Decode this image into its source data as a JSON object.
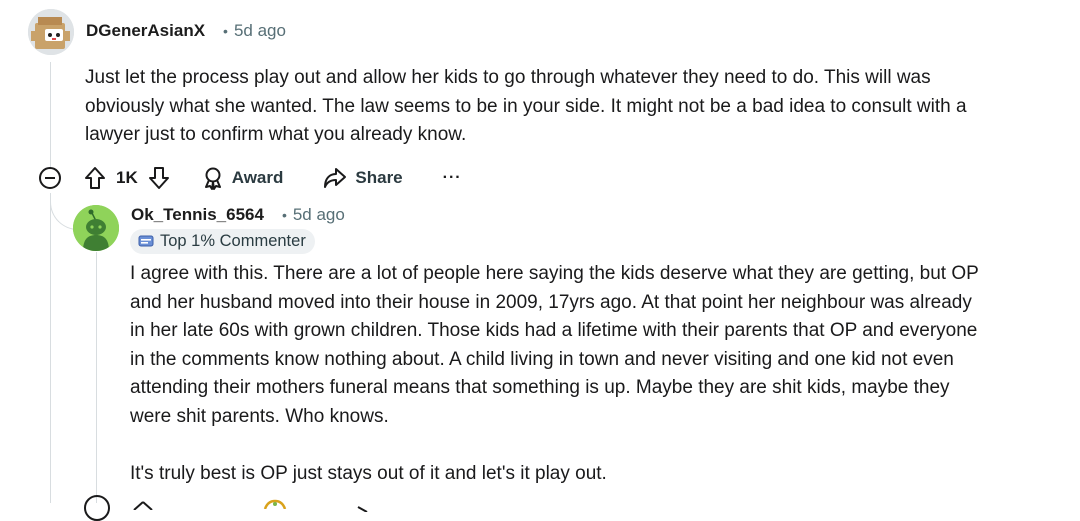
{
  "comment": {
    "username": "DGenerAsianX",
    "separator": "•",
    "time": "5d ago",
    "body_lines": [
      "Just let the process play out and allow her kids to go through whatever they need to do. This will was",
      "obviously what she wanted. The law seems to be in your side. It might not be a bad idea to consult with a",
      "lawyer just to confirm what you already know."
    ],
    "actions": {
      "vote_count": "1K",
      "award_label": "Award",
      "share_label": "Share",
      "more_label": "···"
    }
  },
  "reply": {
    "username": "Ok_Tennis_6564",
    "separator": "•",
    "time": "5d ago",
    "badge_label": "Top 1% Commenter",
    "paragraph1_lines": [
      "I agree with this. There are a lot of people here saying the kids deserve what they are getting, but OP",
      "and her husband moved into their house in 2009, 17yrs ago. At that point her neighbour was already",
      "in her late 60s with grown children. Those kids had a lifetime with their parents that OP and everyone",
      "in the comments know nothing about. A child living in town and never visiting and one kid not even",
      "attending their mothers funeral means that something is up. Maybe they are shit kids, maybe they",
      "were shit parents. Who knows."
    ],
    "paragraph2": "It's truly best is OP just stays out of it and let's it play out."
  },
  "colors": {
    "text": "#1a1a1b",
    "meta": "#576f76",
    "thread_line": "#d8dde0",
    "badge_bg": "#eef1f3",
    "avatar_green": "#85d14c"
  }
}
